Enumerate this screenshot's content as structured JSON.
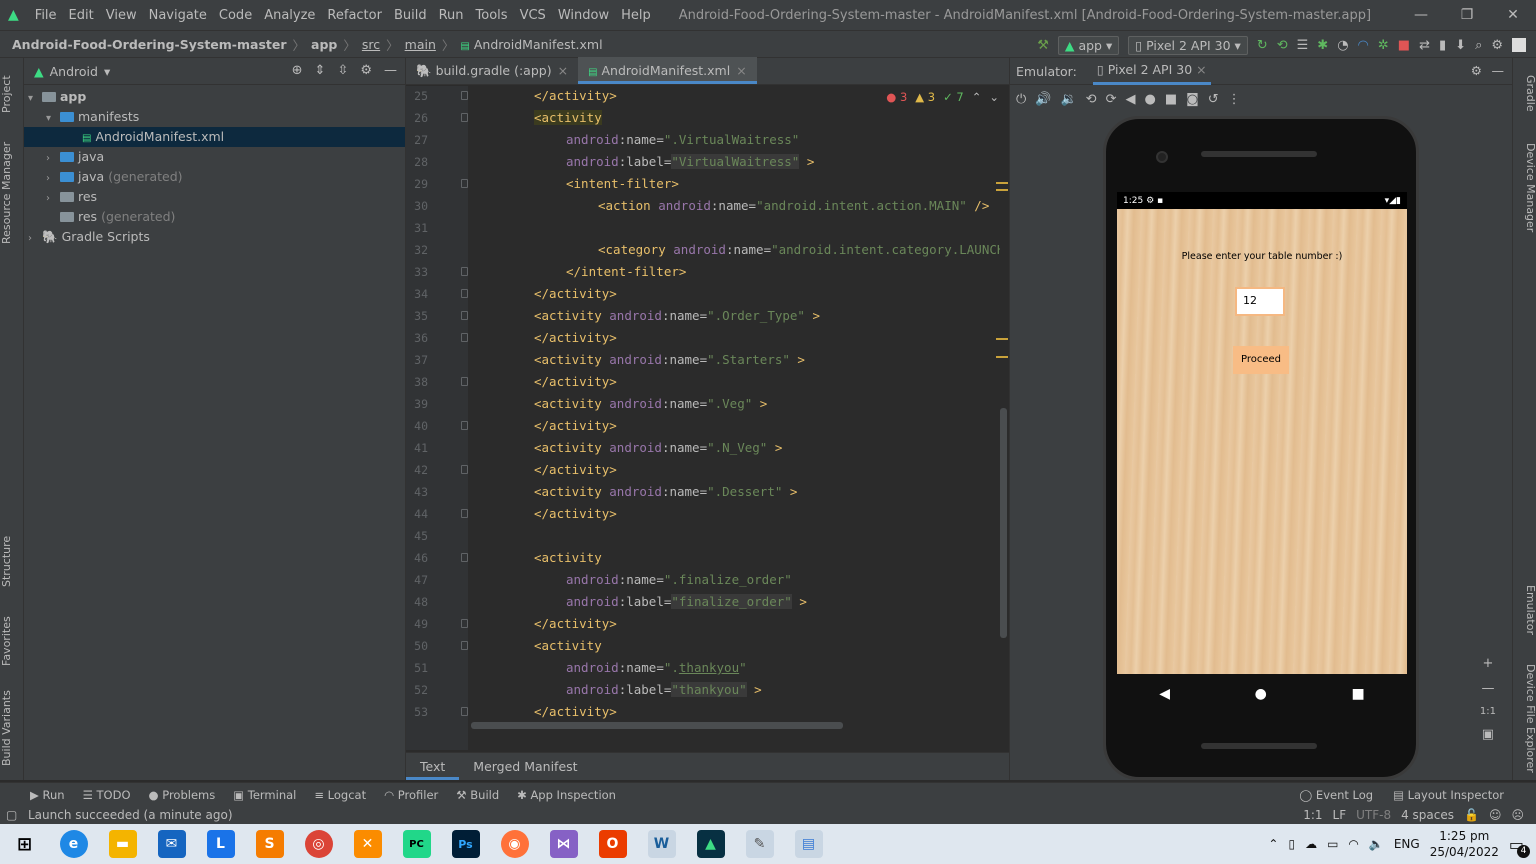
{
  "menubar": {
    "items": [
      "File",
      "Edit",
      "View",
      "Navigate",
      "Code",
      "Analyze",
      "Refactor",
      "Build",
      "Run",
      "Tools",
      "VCS",
      "Window",
      "Help"
    ],
    "window_title": "Android-Food-Ordering-System-master - AndroidManifest.xml [Android-Food-Ordering-System-master.app]"
  },
  "navbar": {
    "crumbs": [
      "Android-Food-Ordering-System-master",
      "app",
      "src",
      "main",
      "AndroidManifest.xml"
    ],
    "run_config": "app",
    "device": "Pixel 2 API 30"
  },
  "left_stripe": {
    "tabs": [
      "Project",
      "Resource Manager",
      "Structure",
      "Favorites",
      "Build Variants"
    ]
  },
  "project": {
    "view_selector": "Android",
    "tree": [
      {
        "label": "app"
      },
      {
        "label": "manifests"
      },
      {
        "label": "AndroidManifest.xml"
      },
      {
        "label": "java"
      },
      {
        "label": "java",
        "suffix": "(generated)"
      },
      {
        "label": "res"
      },
      {
        "label": "res",
        "suffix": "(generated)"
      },
      {
        "label": "Gradle Scripts"
      }
    ]
  },
  "editor": {
    "tabs": [
      "build.gradle (:app)",
      "AndroidManifest.xml"
    ],
    "inspections": {
      "errors": "3",
      "warnings": "3",
      "weak": "7"
    },
    "line_numbers": [
      "25",
      "26",
      "27",
      "28",
      "29",
      "30",
      "31",
      "32",
      "33",
      "34",
      "35",
      "36",
      "37",
      "38",
      "39",
      "40",
      "41",
      "42",
      "43",
      "44",
      "45",
      "46",
      "47",
      "48",
      "49",
      "50",
      "51",
      "52",
      "53"
    ],
    "bottom_tabs": [
      "Text",
      "Merged Manifest"
    ]
  },
  "emulator": {
    "label": "Emulator:",
    "device_tab": "Pixel 2 API 30",
    "status_time": "1:25",
    "prompt": "Please enter your table number :)",
    "table_number": "12",
    "proceed_label": "Proceed",
    "zoom_label": "1:1"
  },
  "right_stripe": {
    "tabs": [
      "Gradle",
      "Device Manager",
      "Emulator",
      "Device File Explorer"
    ]
  },
  "toolwindows": {
    "left": [
      "Run",
      "TODO",
      "Problems",
      "Terminal",
      "Logcat",
      "Profiler",
      "Build",
      "App Inspection"
    ],
    "right": [
      "Event Log",
      "Layout Inspector"
    ]
  },
  "status": {
    "message": "Launch succeeded (a minute ago)",
    "position": "1:1",
    "line_sep": "LF",
    "encoding": "UTF-8",
    "indent": "4 spaces"
  },
  "taskbar": {
    "language": "ENG",
    "time": "1:25 pm",
    "date": "25/04/2022",
    "notifications": "4"
  },
  "colors": {
    "accent": "#4a88c7",
    "android_green": "#3ddc84",
    "tag": "#e8bf6a",
    "value": "#6a8759",
    "namespace": "#9876aa"
  }
}
